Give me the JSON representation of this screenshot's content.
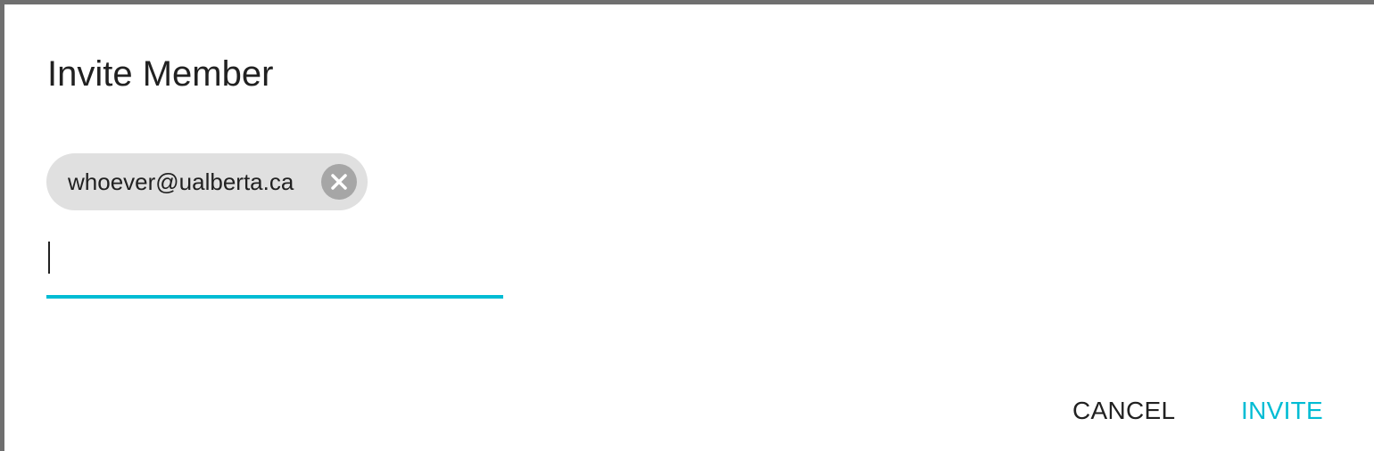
{
  "dialog": {
    "title": "Invite Member",
    "chips": [
      {
        "label": "whoever@ualberta.ca",
        "delete_icon": "close-circle-icon"
      }
    ],
    "input": {
      "value": "",
      "placeholder": ""
    },
    "actions": {
      "cancel_label": "CANCEL",
      "invite_label": "INVITE"
    }
  },
  "colors": {
    "accent": "#00bcd4",
    "chip_background": "#e0e0e0",
    "chip_delete_background": "#a6a6a6",
    "text_primary": "#212121",
    "backdrop": "#6f6f6f"
  }
}
